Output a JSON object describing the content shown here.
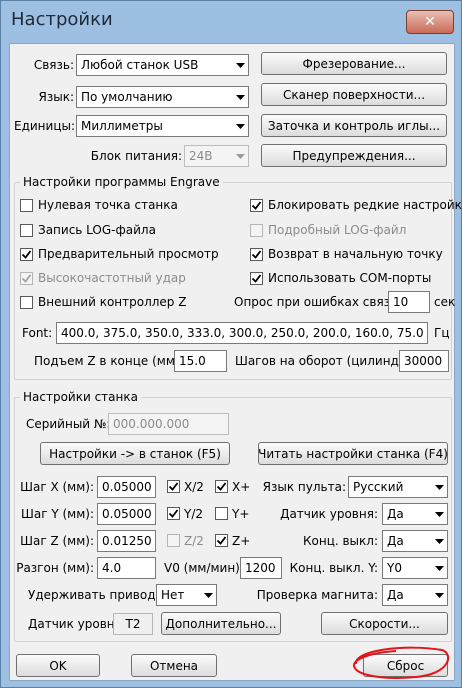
{
  "window": {
    "title": "Настройки",
    "close_glyph": "✕"
  },
  "top": {
    "connection_label": "Связь:",
    "connection_value": "Любой станок USB",
    "language_label": "Язык:",
    "language_value": "По умолчанию",
    "units_label": "Единицы:",
    "units_value": "Миллиметры",
    "power_label": "Блок питания:",
    "power_value": "24В",
    "btn_milling": "Фрезерование...",
    "btn_scanner": "Сканер поверхности...",
    "btn_sharpen": "Заточка и контроль иглы...",
    "btn_warnings": "Предупреждения..."
  },
  "engrave": {
    "title": "Настройки программы Engrave",
    "checks": [
      {
        "label": "Нулевая точка станка",
        "checked": false,
        "disabled": false
      },
      {
        "label": "Блокировать редкие настройки",
        "checked": true,
        "disabled": false
      },
      {
        "label": "Запись LOG-файла",
        "checked": false,
        "disabled": false
      },
      {
        "label": "Подробный LOG-файл",
        "checked": false,
        "disabled": true
      },
      {
        "label": "Предварительный просмотр",
        "checked": true,
        "disabled": false
      },
      {
        "label": "Возврат в начальную точку",
        "checked": true,
        "disabled": false
      },
      {
        "label": "Высокочастотный удар",
        "checked": true,
        "disabled": true
      },
      {
        "label": "Использовать COM-порты",
        "checked": true,
        "disabled": false
      },
      {
        "label": "Внешний контроллер Z",
        "checked": false,
        "disabled": false
      }
    ],
    "poll_label": "Опрос при ошибках связи:",
    "poll_value": "10",
    "poll_unit": "сек",
    "font_label": "Font:",
    "font_value": "400.0, 375.0, 350.0, 333.0, 300.0, 250.0, 200.0, 160.0, 75.0",
    "font_unit": "Гц",
    "lift_label": "Подъем Z в конце (мм):",
    "lift_value": "15.0",
    "steps_label": "Шагов на оборот (цилиндр):",
    "steps_value": "30000"
  },
  "machine": {
    "title": "Настройки станка",
    "serial_label": "Серийный №:",
    "serial_value": "000.000.000",
    "btn_to_machine": "Настройки -> в станок (F5)",
    "btn_read": "Читать настройки станка (F4)",
    "stepx_label": "Шаг X (мм):",
    "stepx_value": "0.05000",
    "stepy_label": "Шаг Y (мм):",
    "stepy_value": "0.05000",
    "stepz_label": "Шаг Z (мм):",
    "stepz_value": "0.01250",
    "x2": "X/2",
    "xplus": "X+",
    "y2": "Y/2",
    "yplus": "Y+",
    "z2": "Z/2",
    "zplus": "Z+",
    "x2_checked": true,
    "xplus_checked": true,
    "y2_checked": true,
    "yplus_checked": false,
    "z2_checked": false,
    "zplus_checked": true,
    "accel_label": "Разгон (мм):",
    "accel_value": "4.0",
    "v0_label": "V0 (мм/мин):",
    "v0_value": "1200",
    "pendant_lang_label": "Язык пульта:",
    "pendant_lang_value": "Русский",
    "level_sensor_label": "Датчик уровня:",
    "level_sensor_value": "Да",
    "limit_label": "Конц. выкл:",
    "limit_value": "Да",
    "limit_y_label": "Конц. выкл. Y:",
    "limit_y_value": "Y0",
    "hold_label": "Удерживать приводы:",
    "hold_value": "Нет",
    "magnet_label": "Проверка магнита:",
    "magnet_value": "Да",
    "sensor_label": "Датчик уровня:",
    "sensor_value": "T2",
    "btn_more": "Дополнительно...",
    "btn_speeds": "Скорости..."
  },
  "bottom": {
    "ok": "OK",
    "cancel": "Отмена",
    "reset": "Сброс"
  }
}
